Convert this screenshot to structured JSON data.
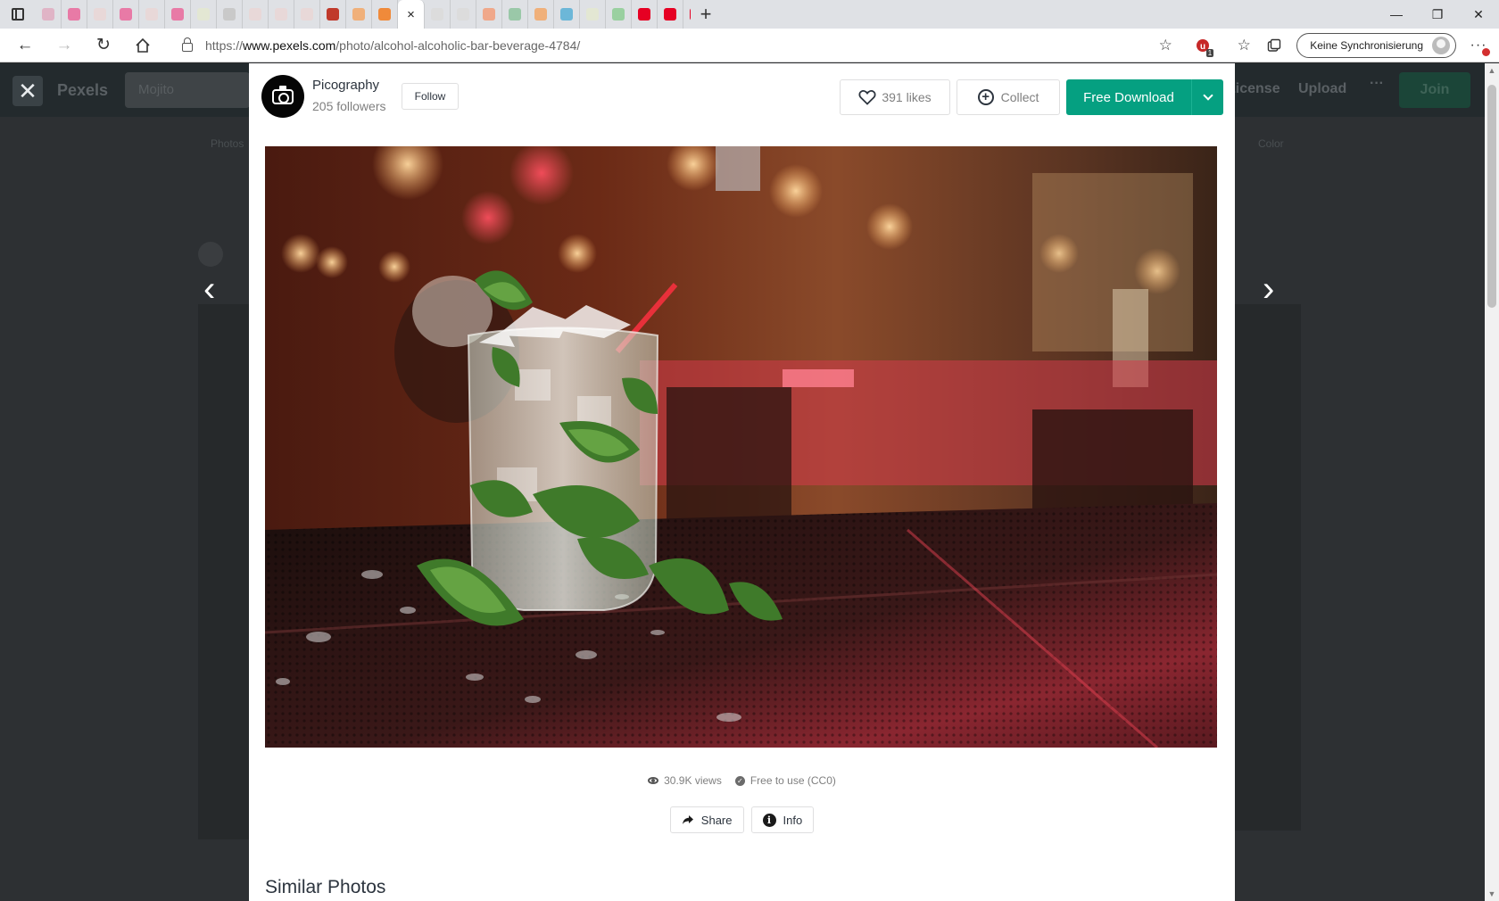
{
  "browser": {
    "tab_favicon_colors": [
      "#e0b4c6",
      "#e87aa6",
      "#e8d8d8",
      "#e87aa6",
      "#e8d8d8",
      "#e87aa6",
      "#e3e7d3",
      "#c9c9c9",
      "#e8d8d8",
      "#e8d8d8",
      "#e8d8d8",
      "#c0392b",
      "#f0b07a",
      "#f08a3a",
      "#ffffff",
      "#dcdcdc",
      "#dcdcdc",
      "#f0a88a",
      "#9ac8a8",
      "#f0b07a",
      "#6cb7d8",
      "#e3e7d3",
      "#9ad0a0",
      "#e60023",
      "#e60023",
      "#e60023",
      "#e60023",
      "#e60023",
      "#e60023",
      "#05a081",
      "#dcdcdc",
      "#222222",
      "#777777",
      "#f0b07a",
      "#5577aa",
      "#5577aa",
      "#b05545",
      "#6b8fb0",
      "#f0b07a",
      "#777777",
      "#e0c060",
      "#e06060",
      "#d080a0",
      "#e06080",
      "#6b8fb0",
      "#333333",
      "#f0b07a",
      "#777777",
      "#e06060"
    ],
    "active_tab_close": "×",
    "new_tab": "+",
    "window_controls": [
      "—",
      "❐",
      "✕"
    ],
    "url_scheme": "https://",
    "url_host": "www.pexels.com",
    "url_path": "/photo/alcohol-alcoholic-bar-beverage-4784/",
    "ext_badge": "1",
    "sync_label": "Keine Synchronisierung"
  },
  "background_page": {
    "logo": "Pexels",
    "search_placeholder": "Mojito",
    "nav_license": "License",
    "nav_upload": "Upload",
    "nav_more": "···",
    "nav_join": "Join",
    "sub_left": "Photos",
    "sub_right": "Color"
  },
  "modal": {
    "photographer": "Picography",
    "followers": "205 followers",
    "follow_label": "Follow",
    "likes_label": "391 likes",
    "collect_label": "Collect",
    "download_label": "Free Download",
    "views": "30.9K views",
    "license": "Free to use (CC0)",
    "share_label": "Share",
    "info_label": "Info",
    "similar_heading": "Similar Photos"
  },
  "icons": {
    "camera": "camera-icon",
    "heart": "heart-icon",
    "plus": "plus-circle-icon",
    "eye": "eye-icon",
    "check": "check-circle-icon",
    "share": "share-arrow-icon",
    "info": "info-icon"
  },
  "colors": {
    "accent": "#05a081",
    "modal_bg": "#ffffff",
    "overlay_bg": "#2d3033"
  }
}
